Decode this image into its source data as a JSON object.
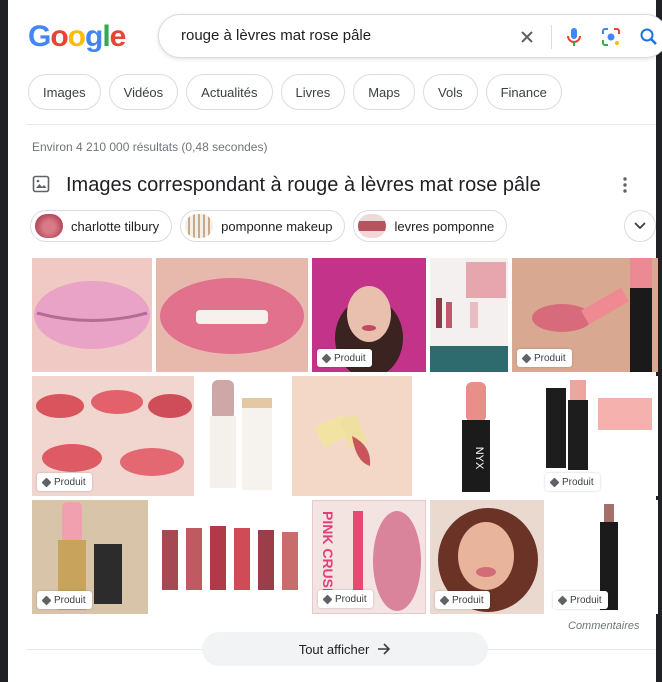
{
  "search": {
    "query": "rouge à lèvres mat rose pâle"
  },
  "logo": {
    "letters": [
      "G",
      "o",
      "o",
      "g",
      "l",
      "e"
    ],
    "colors": [
      "#4285f4",
      "#ea4335",
      "#fbbc05",
      "#4285f4",
      "#34a853",
      "#ea4335"
    ]
  },
  "filters": [
    "Images",
    "Vidéos",
    "Actualités",
    "Livres",
    "Maps",
    "Vols",
    "Finance"
  ],
  "stats": "Environ 4 210 000 résultats (0,48 secondes)",
  "images_section": {
    "title": "Images correspondant à rouge à lèvres mat rose pâle",
    "suggestions": [
      "charlotte tilbury",
      "pomponne makeup",
      "levres pomponne"
    ],
    "product_tag": "Produit",
    "comments": "Commentaires",
    "show_all": "Tout afficher"
  },
  "colors": {
    "accent_blue": "#1a73e8",
    "mic_blue": "#4285f4",
    "lipstick_pink": "#e9a0ae",
    "lipstick_red": "#c9485a"
  },
  "icons": [
    "clear-icon",
    "mic-icon",
    "lens-icon",
    "search-icon",
    "image-icon",
    "more-vert-icon",
    "chevron-down-icon",
    "arrow-right-icon",
    "tag-icon"
  ]
}
